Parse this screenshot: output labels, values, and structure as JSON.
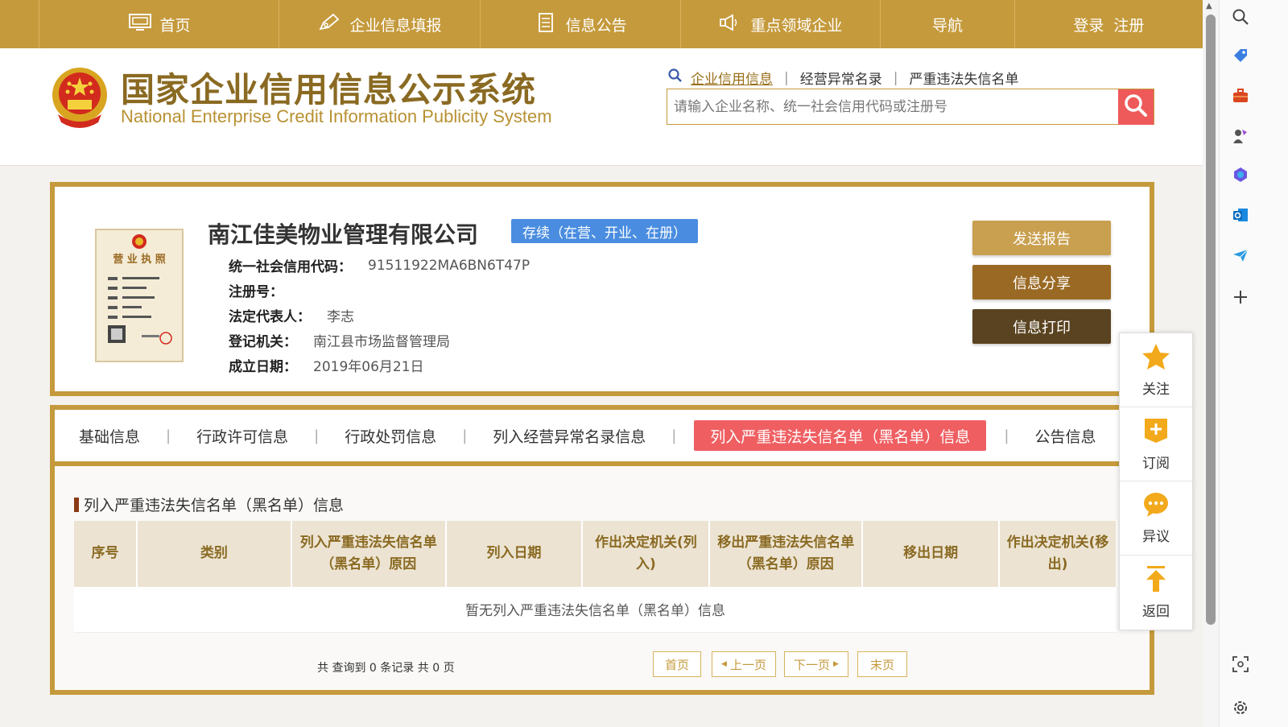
{
  "nav": {
    "home": "首页",
    "fill_info": "企业信息填报",
    "announcement": "信息公告",
    "key_areas": "重点领域企业",
    "navigation": "导航",
    "login_register": "登录  注册"
  },
  "header": {
    "title_cn": "国家企业信用信息公示系统",
    "title_en": "National Enterprise Credit Information Publicity System",
    "search_tabs": [
      "企业信用信息",
      "经营异常名录",
      "严重违法失信名单"
    ],
    "search_placeholder": "请输入企业名称、统一社会信用代码或注册号"
  },
  "company": {
    "name": "南江佳美物业管理有限公司",
    "status": "存续（在营、开业、在册）",
    "fields": [
      {
        "label": "统一社会信用代码：",
        "value": "91511922MA6BN6T47P"
      },
      {
        "label": "注册号：",
        "value": ""
      },
      {
        "label": "法定代表人：",
        "value": "李志"
      },
      {
        "label": "登记机关：",
        "value": "南江县市场监督管理局"
      },
      {
        "label": "成立日期：",
        "value": "2019年06月21日"
      }
    ],
    "license_text": "营 业 执 照",
    "actions": {
      "send_report": "发送报告",
      "share": "信息分享",
      "print": "信息打印"
    }
  },
  "tabs": [
    "基础信息",
    "行政许可信息",
    "行政处罚信息",
    "列入经营异常名录信息",
    "列入严重违法失信名单（黑名单）信息",
    "公告信息"
  ],
  "section": {
    "title": "列入严重违法失信名单（黑名单）信息",
    "columns": [
      "序号",
      "类别",
      "列入严重违法失信名单（黑名单）原因",
      "列入日期",
      "作出决定机关(列入)",
      "移出严重违法失信名单（黑名单）原因",
      "移出日期",
      "作出决定机关(移出)"
    ],
    "empty_text": "暂无列入严重违法失信名单（黑名单）信息"
  },
  "pager": {
    "summary_prefix": "共 查询到",
    "record_count": "0",
    "summary_mid": "条记录 共",
    "page_count": "0",
    "summary_suffix": "页",
    "first": "首页",
    "prev": "上一页",
    "next": "下一页",
    "last": "末页"
  },
  "float_panel": {
    "follow": "关注",
    "subscribe": "订阅",
    "objection": "异议",
    "back": "返回"
  },
  "colors": {
    "brand_gold": "#c59a3c",
    "status_blue": "#4a8de0",
    "active_tab_red": "#ef5f62",
    "btn_send": "#c59a3c",
    "btn_share": "#9a6a24",
    "btn_print": "#5a4320"
  }
}
